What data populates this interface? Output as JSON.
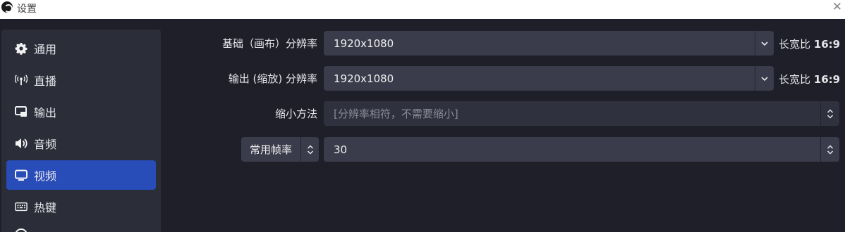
{
  "window": {
    "title": "设置",
    "close_glyph": "✕"
  },
  "sidebar": {
    "items": [
      {
        "label": "通用",
        "icon": "gear-icon"
      },
      {
        "label": "直播",
        "icon": "broadcast-icon"
      },
      {
        "label": "输出",
        "icon": "output-icon"
      },
      {
        "label": "音频",
        "icon": "speaker-icon"
      },
      {
        "label": "视频",
        "icon": "monitor-icon",
        "active": true
      },
      {
        "label": "热键",
        "icon": "keyboard-icon"
      }
    ]
  },
  "video": {
    "base_resolution": {
      "label": "基础（画布）分辨率",
      "value": "1920x1080",
      "aspect_prefix": "长宽比",
      "aspect_value": "16:9"
    },
    "output_resolution": {
      "label": "输出 (缩放) 分辨率",
      "value": "1920x1080",
      "aspect_prefix": "长宽比",
      "aspect_value": "16:9"
    },
    "downscale_filter": {
      "label": "缩小方法",
      "value": "[分辨率相符，不需要缩小]"
    },
    "fps": {
      "type_label": "常用帧率",
      "value": "30"
    }
  },
  "colors": {
    "background": "#1e1f29",
    "sidebar": "#2b2d39",
    "active": "#284cb8",
    "field": "#3b3c4b"
  }
}
